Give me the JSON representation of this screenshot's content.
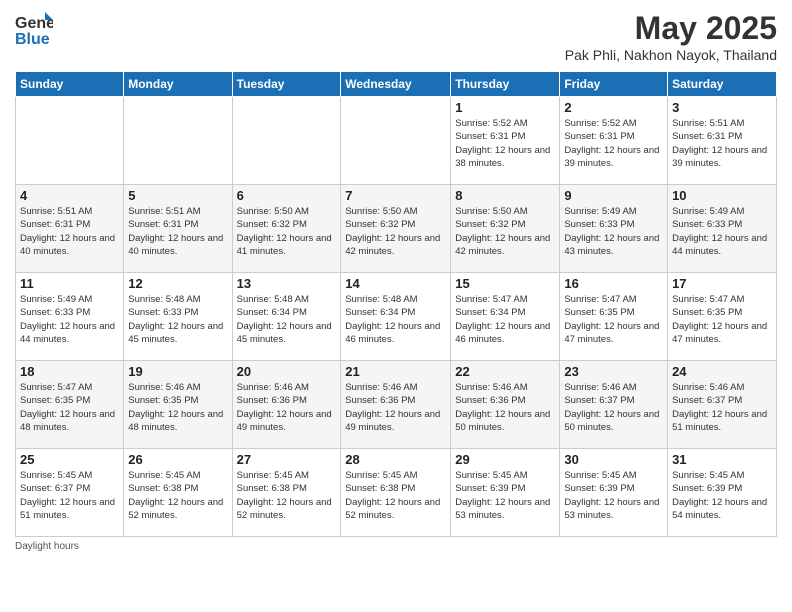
{
  "logo": {
    "general": "General",
    "blue": "Blue"
  },
  "title": "May 2025",
  "subtitle": "Pak Phli, Nakhon Nayok, Thailand",
  "headers": [
    "Sunday",
    "Monday",
    "Tuesday",
    "Wednesday",
    "Thursday",
    "Friday",
    "Saturday"
  ],
  "footer": "Daylight hours",
  "weeks": [
    [
      {
        "day": "",
        "info": ""
      },
      {
        "day": "",
        "info": ""
      },
      {
        "day": "",
        "info": ""
      },
      {
        "day": "",
        "info": ""
      },
      {
        "day": "1",
        "info": "Sunrise: 5:52 AM\nSunset: 6:31 PM\nDaylight: 12 hours\nand 38 minutes."
      },
      {
        "day": "2",
        "info": "Sunrise: 5:52 AM\nSunset: 6:31 PM\nDaylight: 12 hours\nand 39 minutes."
      },
      {
        "day": "3",
        "info": "Sunrise: 5:51 AM\nSunset: 6:31 PM\nDaylight: 12 hours\nand 39 minutes."
      }
    ],
    [
      {
        "day": "4",
        "info": "Sunrise: 5:51 AM\nSunset: 6:31 PM\nDaylight: 12 hours\nand 40 minutes."
      },
      {
        "day": "5",
        "info": "Sunrise: 5:51 AM\nSunset: 6:31 PM\nDaylight: 12 hours\nand 40 minutes."
      },
      {
        "day": "6",
        "info": "Sunrise: 5:50 AM\nSunset: 6:32 PM\nDaylight: 12 hours\nand 41 minutes."
      },
      {
        "day": "7",
        "info": "Sunrise: 5:50 AM\nSunset: 6:32 PM\nDaylight: 12 hours\nand 42 minutes."
      },
      {
        "day": "8",
        "info": "Sunrise: 5:50 AM\nSunset: 6:32 PM\nDaylight: 12 hours\nand 42 minutes."
      },
      {
        "day": "9",
        "info": "Sunrise: 5:49 AM\nSunset: 6:33 PM\nDaylight: 12 hours\nand 43 minutes."
      },
      {
        "day": "10",
        "info": "Sunrise: 5:49 AM\nSunset: 6:33 PM\nDaylight: 12 hours\nand 44 minutes."
      }
    ],
    [
      {
        "day": "11",
        "info": "Sunrise: 5:49 AM\nSunset: 6:33 PM\nDaylight: 12 hours\nand 44 minutes."
      },
      {
        "day": "12",
        "info": "Sunrise: 5:48 AM\nSunset: 6:33 PM\nDaylight: 12 hours\nand 45 minutes."
      },
      {
        "day": "13",
        "info": "Sunrise: 5:48 AM\nSunset: 6:34 PM\nDaylight: 12 hours\nand 45 minutes."
      },
      {
        "day": "14",
        "info": "Sunrise: 5:48 AM\nSunset: 6:34 PM\nDaylight: 12 hours\nand 46 minutes."
      },
      {
        "day": "15",
        "info": "Sunrise: 5:47 AM\nSunset: 6:34 PM\nDaylight: 12 hours\nand 46 minutes."
      },
      {
        "day": "16",
        "info": "Sunrise: 5:47 AM\nSunset: 6:35 PM\nDaylight: 12 hours\nand 47 minutes."
      },
      {
        "day": "17",
        "info": "Sunrise: 5:47 AM\nSunset: 6:35 PM\nDaylight: 12 hours\nand 47 minutes."
      }
    ],
    [
      {
        "day": "18",
        "info": "Sunrise: 5:47 AM\nSunset: 6:35 PM\nDaylight: 12 hours\nand 48 minutes."
      },
      {
        "day": "19",
        "info": "Sunrise: 5:46 AM\nSunset: 6:35 PM\nDaylight: 12 hours\nand 48 minutes."
      },
      {
        "day": "20",
        "info": "Sunrise: 5:46 AM\nSunset: 6:36 PM\nDaylight: 12 hours\nand 49 minutes."
      },
      {
        "day": "21",
        "info": "Sunrise: 5:46 AM\nSunset: 6:36 PM\nDaylight: 12 hours\nand 49 minutes."
      },
      {
        "day": "22",
        "info": "Sunrise: 5:46 AM\nSunset: 6:36 PM\nDaylight: 12 hours\nand 50 minutes."
      },
      {
        "day": "23",
        "info": "Sunrise: 5:46 AM\nSunset: 6:37 PM\nDaylight: 12 hours\nand 50 minutes."
      },
      {
        "day": "24",
        "info": "Sunrise: 5:46 AM\nSunset: 6:37 PM\nDaylight: 12 hours\nand 51 minutes."
      }
    ],
    [
      {
        "day": "25",
        "info": "Sunrise: 5:45 AM\nSunset: 6:37 PM\nDaylight: 12 hours\nand 51 minutes."
      },
      {
        "day": "26",
        "info": "Sunrise: 5:45 AM\nSunset: 6:38 PM\nDaylight: 12 hours\nand 52 minutes."
      },
      {
        "day": "27",
        "info": "Sunrise: 5:45 AM\nSunset: 6:38 PM\nDaylight: 12 hours\nand 52 minutes."
      },
      {
        "day": "28",
        "info": "Sunrise: 5:45 AM\nSunset: 6:38 PM\nDaylight: 12 hours\nand 52 minutes."
      },
      {
        "day": "29",
        "info": "Sunrise: 5:45 AM\nSunset: 6:39 PM\nDaylight: 12 hours\nand 53 minutes."
      },
      {
        "day": "30",
        "info": "Sunrise: 5:45 AM\nSunset: 6:39 PM\nDaylight: 12 hours\nand 53 minutes."
      },
      {
        "day": "31",
        "info": "Sunrise: 5:45 AM\nSunset: 6:39 PM\nDaylight: 12 hours\nand 54 minutes."
      }
    ]
  ]
}
